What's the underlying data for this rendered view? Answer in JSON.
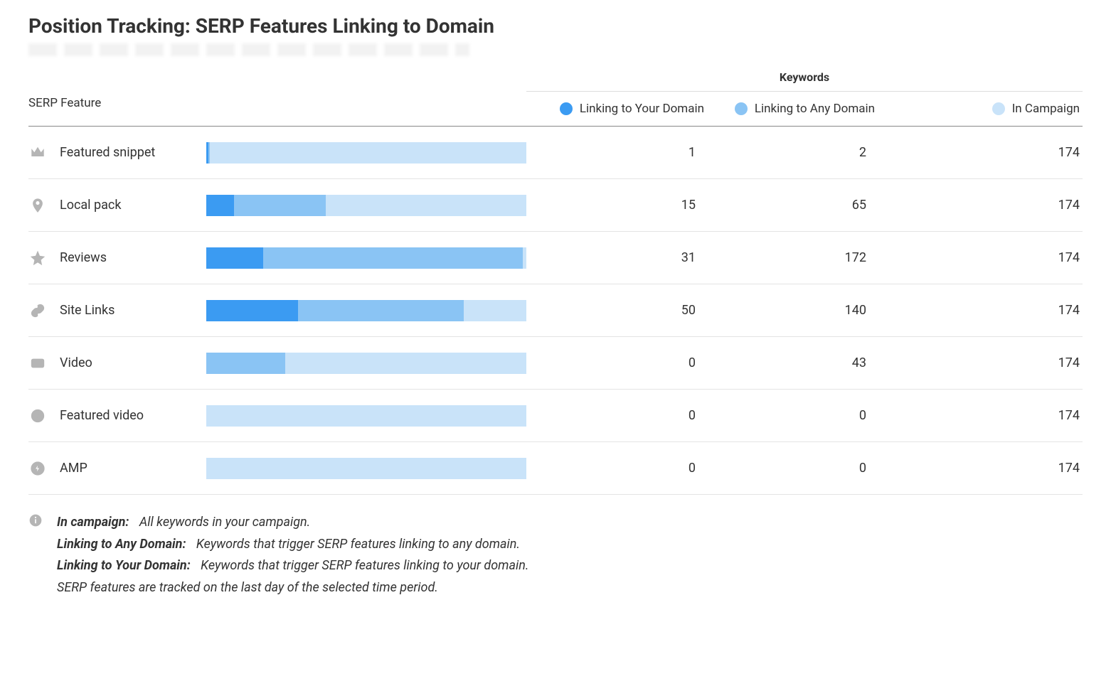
{
  "title": "Position Tracking: SERP Features Linking to Domain",
  "headers": {
    "serp": "SERP Feature",
    "keywords": "Keywords",
    "your": "Linking to Your Domain",
    "any": "Linking to Any Domain",
    "camp": "In Campaign"
  },
  "colors": {
    "your": "#3b9bf2",
    "any": "#8ac4f4",
    "camp": "#c9e3f9"
  },
  "rows": [
    {
      "icon": "crown",
      "name": "Featured snippet",
      "your": 1,
      "any": 2,
      "camp": 174
    },
    {
      "icon": "pin",
      "name": "Local pack",
      "your": 15,
      "any": 65,
      "camp": 174
    },
    {
      "icon": "star",
      "name": "Reviews",
      "your": 31,
      "any": 172,
      "camp": 174
    },
    {
      "icon": "link",
      "name": "Site Links",
      "your": 50,
      "any": 140,
      "camp": 174
    },
    {
      "icon": "video",
      "name": "Video",
      "your": 0,
      "any": 43,
      "camp": 174
    },
    {
      "icon": "playcirc",
      "name": "Featured video",
      "your": 0,
      "any": 0,
      "camp": 174
    },
    {
      "icon": "amp",
      "name": "AMP",
      "your": 0,
      "any": 0,
      "camp": 174
    }
  ],
  "footer": {
    "in_campaign_label": "In campaign:",
    "in_campaign_def": "All keywords in your campaign.",
    "any_label": "Linking to Any Domain:",
    "any_def": "Keywords that trigger SERP features linking to any domain.",
    "your_label": "Linking to Your Domain:",
    "your_def": "Keywords that trigger SERP features linking to your domain.",
    "note": "SERP features are tracked on the last day of the selected time period."
  },
  "chart_data": {
    "type": "bar",
    "orientation": "horizontal",
    "stacked": true,
    "title": "Position Tracking: SERP Features Linking to Domain",
    "categories": [
      "Featured snippet",
      "Local pack",
      "Reviews",
      "Site Links",
      "Video",
      "Featured video",
      "AMP"
    ],
    "series": [
      {
        "name": "Linking to Your Domain",
        "values": [
          1,
          15,
          31,
          50,
          0,
          0,
          0
        ],
        "color": "#3b9bf2"
      },
      {
        "name": "Linking to Any Domain",
        "values": [
          2,
          65,
          172,
          140,
          43,
          0,
          0
        ],
        "color": "#8ac4f4"
      },
      {
        "name": "In Campaign",
        "values": [
          174,
          174,
          174,
          174,
          174,
          174,
          174
        ],
        "color": "#c9e3f9"
      }
    ],
    "xlabel": "Keywords",
    "ylabel": "SERP Feature",
    "xlim": [
      0,
      174
    ]
  }
}
